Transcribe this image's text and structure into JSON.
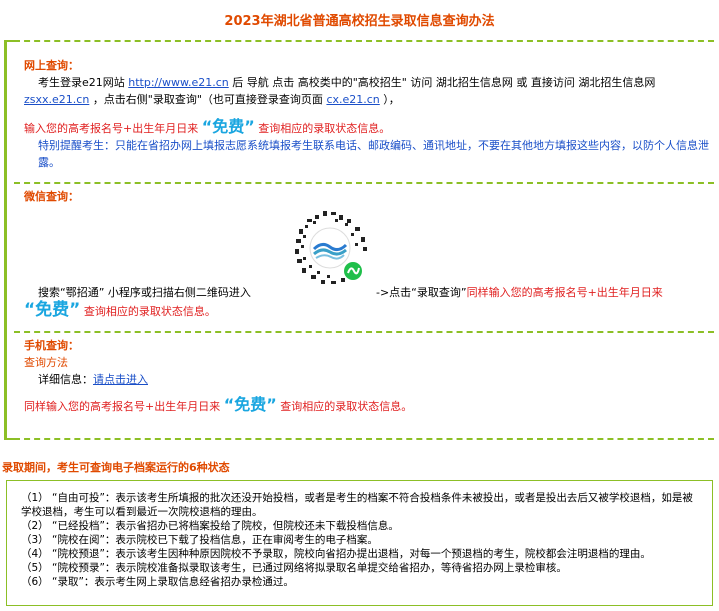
{
  "title": "2023年湖北省普通高校招生录取信息查询办法",
  "online": {
    "heading": "网上查询：",
    "line1_a": "考生登录e21网站",
    "line1_link": "http://www.e21.cn",
    "line1_b": "后 导航 点击 高校类中的\"高校招生\" 访问 湖北招生信息网 或 直接访问 湖北招生信息网",
    "line2_link1": "zsxx.e21.cn",
    "line2_a": "，点击右侧\"录取查询\"（也可直接登录查询页面",
    "line2_link2": "cx.e21.cn",
    "line2_b": "），",
    "input_a": "输入您的高考报名号+出生年月日来",
    "free": "“免费”",
    "input_b": "查询相应的录取状态信息。",
    "notice": "特别提醒考生：只能在省招办网上填报志愿系统填报考生联系电话、邮政编码、通讯地址，不要在其他地方填报这些内容，以防个人信息泄露。"
  },
  "wechat": {
    "heading": "微信查询：",
    "search_text": "搜索“鄂招通” 小程序或扫描右侧二维码进入",
    "arrow_text": "->点击“录取查询”",
    "input_a": "同样输入您的高考报名号+出生年月日来",
    "free": "“免费”",
    "input_b": "查询相应的录取状态信息。"
  },
  "mobile": {
    "heading": "手机查询：",
    "method": "查询方法",
    "detail_label": "详细信息：",
    "detail_link": "请点击进入",
    "input_a": "同样输入您的高考报名号+出生年月日来",
    "free": "“免费”",
    "input_b": "查询相应的录取状态信息。"
  },
  "states": {
    "title": "录取期间，考生可查询电子档案运行的6种状态",
    "items": [
      "（1） “自由可投”：表示该考生所填报的批次还没开始投档，或者是考生的档案不符合投档条件未被投出，或者是投出去后又被学校退档，如是被学校退档，考生可以看到最近一次院校退档的理由。",
      "（2） “已经投档”：表示省招办已将档案投给了院校，但院校还未下载投档信息。",
      "（3） “院校在阅”：表示院校已下载了投档信息，正在审阅考生的电子档案。",
      "（4） “院校预退”：表示该考生因种种原因院校不予录取，院校向省招办提出退档，对每一个预退档的考生，院校都会注明退档的理由。",
      "（5） “院校预录”：表示院校准备拟录取该考生，已通过网络将拟录取名单提交给省招办，等待省招办网上录检审核。",
      "（6） “录取”：表示考生网上录取信息经省招办录检通过。"
    ]
  },
  "colors": {
    "accent": "#e04a00",
    "border": "#8cbf26",
    "link": "#1a4fc8",
    "free": "#1aa6e0",
    "warn": "#e02020"
  },
  "icons": {
    "qr": "wechat-miniprogram-qr-icon"
  }
}
